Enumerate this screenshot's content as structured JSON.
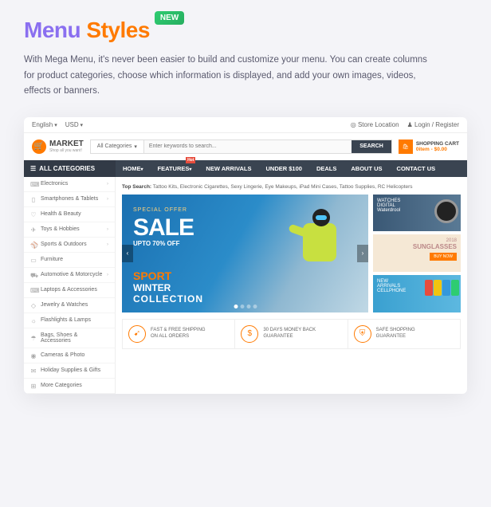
{
  "title": {
    "word1": "Menu",
    "word2": "Styles",
    "badge": "NEW"
  },
  "description": "With Mega Menu, it's never been easier to build and customize your menu. You can create columns for product categories, choose which information is displayed, and add your own images, videos, effects or banners.",
  "topbar": {
    "lang": "English",
    "currency": "USD",
    "store": "Store Location",
    "login": "Login / Register"
  },
  "logo": {
    "name": "MARKET",
    "tag": "Shop all you want!"
  },
  "search": {
    "cat": "All Categories",
    "placeholder": "Enter keywords to search...",
    "btn": "SEARCH"
  },
  "cart": {
    "title": "SHOPPING CART",
    "sub": "0item - $0.00"
  },
  "nav": {
    "all": "ALL CATEGORIES",
    "items": [
      "HOME",
      "FEATURES",
      "NEW ARRIVALS",
      "UNDER $100",
      "DEALS",
      "ABOUT US",
      "CONTACT US"
    ],
    "hot": "Hot"
  },
  "sidebar": [
    "Electronics",
    "Smartphones & Tablets",
    "Health & Beauty",
    "Toys & Hobbies",
    "Sports & Outdoors",
    "Furniture",
    "Automotive & Motorcycle",
    "Laptops & Accessories",
    "Jewelry & Watches",
    "Flashlights & Lamps",
    "Bags, Shoes & Accessories",
    "Cameras & Photo",
    "Holiday Supplies & Gifts",
    "More Categories"
  ],
  "topsearch": {
    "label": "Top Search:",
    "items": "Tattoo Kits,  Electronic Cigarettes,  Sexy Lingerie,  Eye Makeups,  iPad Mini Cases,  Tattoo Supplies,  RC Helicopters"
  },
  "hero": {
    "special": "SPECIAL OFFER",
    "sale": "SALE",
    "off": "UPTO 70% OFF",
    "l1": "SPORT",
    "l2": "WINTER",
    "l3": "COLLECTION"
  },
  "promos": {
    "p1": {
      "l1": "WATCHES",
      "l2": "DIGITAL",
      "l3": "Waterdrool"
    },
    "p2": {
      "year": "2018",
      "label": "SUNGLASSES",
      "btn": "BUY NOW"
    },
    "p3": {
      "l1": "NEW",
      "l2": "ARRIVALS",
      "l3": "CELLPHONE"
    }
  },
  "features": [
    {
      "l1": "FAST & FREE SHIPPING",
      "l2": "ON ALL ORDERS"
    },
    {
      "l1": "30 DAYS MONEY BACK",
      "l2": "GUARANTEE"
    },
    {
      "l1": "SAFE SHOPPING",
      "l2": "GUARANTEE"
    }
  ]
}
